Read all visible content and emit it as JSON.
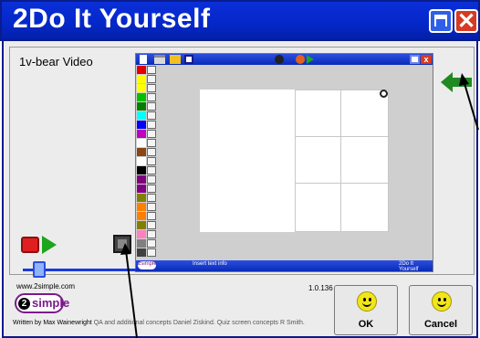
{
  "window": {
    "title": "2Do It Yourself",
    "maximize_icon": "maximize-icon",
    "close_icon": "close-icon"
  },
  "document": {
    "title": "1v-bear Video"
  },
  "mini_app": {
    "status_left": "2simple",
    "status_mid": "Insert text info",
    "status_right": "2Do It Yourself",
    "palette": [
      "#e00000",
      "#ffff00",
      "#ffff00",
      "#00c000",
      "#008000",
      "#00ffff",
      "#0000ff",
      "#c000c0",
      "#ffffff",
      "#8b4513",
      "#ffffff",
      "#000000",
      "#800080",
      "#800080",
      "#808000",
      "#ff8000",
      "#ff8000",
      "#808000",
      "#ff80c0",
      "#808080",
      "#404040"
    ]
  },
  "controls": {
    "record_icon": "record-icon",
    "play_icon": "play-icon",
    "stage_icon": "stage-icon",
    "slider_level": 0.1
  },
  "footer": {
    "site": "www.2simple.com",
    "version": "1.0.136",
    "logo_number": "2",
    "logo_word": "simple",
    "credits_author": "Written by Max Wainewright",
    "credits_rest": "QA and additional concepts Daniel Ziskind. Quiz screen concepts R Smith."
  },
  "buttons": {
    "ok": "OK",
    "cancel": "Cancel"
  },
  "colors": {
    "titlebar": "#0427c8",
    "accent_green": "#1da51d",
    "record_red": "#e02020"
  }
}
